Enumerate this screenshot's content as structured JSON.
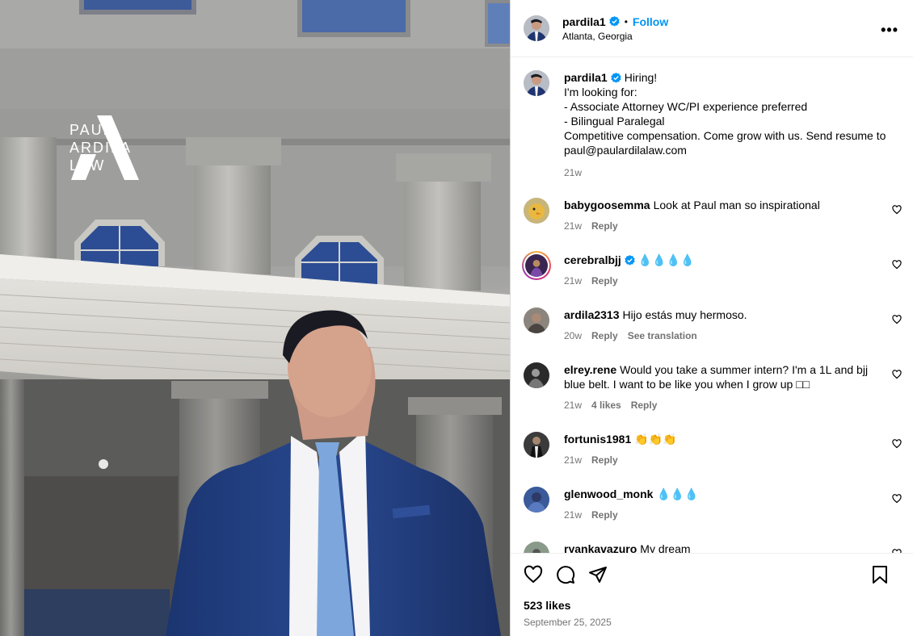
{
  "brand": {
    "line1": "PAUL",
    "line2": "ARDILA",
    "line3": "LAW"
  },
  "post": {
    "author": "pardila1",
    "follow_label": "Follow",
    "dot": "•",
    "location": "Atlanta, Georgia",
    "more_label": "•••",
    "caption": {
      "lines": [
        "Hiring!",
        "I'm looking for:",
        "- Associate Attorney WC/PI experience preferred",
        "- Bilingual Paralegal",
        "Competitive compensation. Come grow with us. Send resume to",
        "paul@paulardilalaw.com"
      ],
      "time": "21w"
    },
    "likes": "523 likes",
    "date": "September 25, 2025"
  },
  "comments": [
    {
      "user": "babygoosemma",
      "text": "Look at Paul man so inspirational",
      "time": "21w",
      "reply": "Reply",
      "avatar_color": "#d9a93a"
    },
    {
      "user": "cerebralbjj",
      "text": "💧💧💧💧",
      "time": "21w",
      "reply": "Reply",
      "verified": true,
      "avatar_color": "#3a2550"
    },
    {
      "user": "ardila2313",
      "text": "Hijo estás muy hermoso.",
      "time": "20w",
      "reply": "Reply",
      "translate": "See translation",
      "avatar_color": "#6f6a65"
    },
    {
      "user": "elrey.rene",
      "text": "Would you take a summer intern? I'm a 1L and bjj blue belt. I want to be like you when I grow up □□",
      "time": "21w",
      "likes": "4 likes",
      "reply": "Reply",
      "avatar_color": "#2a2a2a"
    },
    {
      "user": "fortunis1981",
      "text": "👏👏👏",
      "time": "21w",
      "reply": "Reply",
      "avatar_color": "#3b3b3b"
    },
    {
      "user": "glenwood_monk",
      "text": "💧💧💧",
      "time": "21w",
      "reply": "Reply",
      "avatar_color": "#3a5a9a"
    },
    {
      "user": "ryankavazuro",
      "text": "My dream",
      "time": "",
      "reply": "",
      "avatar_color": "#8a9a8a"
    }
  ],
  "colors": {
    "accent": "#0095f6",
    "secondary_text": "#737373",
    "verified": "#0095f6"
  }
}
